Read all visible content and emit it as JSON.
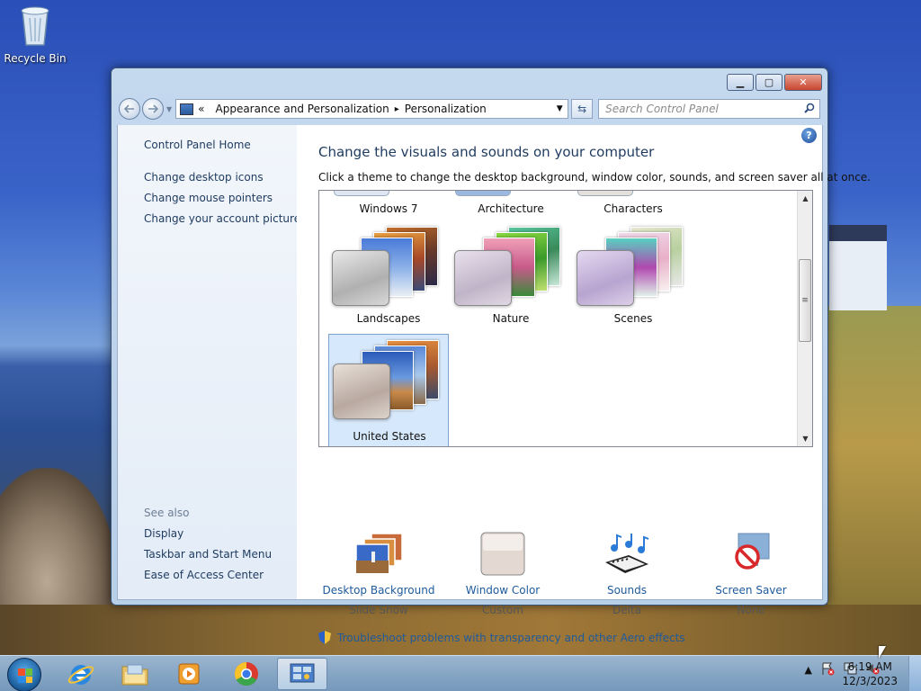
{
  "desktop": {
    "recycle_bin_label": "Recycle Bin"
  },
  "window": {
    "title": "Personalization",
    "controls": {
      "minimize": "▁",
      "maximize": "▢",
      "close": "✕"
    },
    "address": {
      "chevron": "«",
      "crumbs": [
        "Appearance and Personalization",
        "Personalization"
      ],
      "separator": "▸"
    },
    "search": {
      "placeholder": "Search Control Panel"
    }
  },
  "sidebar": {
    "home": "Control Panel Home",
    "tasks": [
      "Change desktop icons",
      "Change mouse pointers",
      "Change your account picture"
    ],
    "see_also_label": "See also",
    "see_also": [
      "Display",
      "Taskbar and Start Menu",
      "Ease of Access Center"
    ]
  },
  "content": {
    "heading": "Change the visuals and sounds on your computer",
    "subheading": "Click a theme to change the desktop background, window color, sounds, and screen saver all at once.",
    "themes_top_row": [
      "Windows 7",
      "Architecture",
      "Characters"
    ],
    "themes": [
      {
        "label": "Landscapes",
        "selected": false
      },
      {
        "label": "Nature",
        "selected": false
      },
      {
        "label": "Scenes",
        "selected": false
      },
      {
        "label": "United States",
        "selected": true
      }
    ],
    "settings": [
      {
        "title": "Desktop Background",
        "value": "Slide Show",
        "icon": "desktop-background-icon"
      },
      {
        "title": "Window Color",
        "value": "Custom",
        "icon": "window-color-icon"
      },
      {
        "title": "Sounds",
        "value": "Delta",
        "icon": "sounds-icon"
      },
      {
        "title": "Screen Saver",
        "value": "None",
        "icon": "screen-saver-icon"
      }
    ],
    "troubleshoot": "Troubleshoot problems with transparency and other Aero effects",
    "help": "?"
  },
  "taskbar": {
    "apps": [
      "internet-explorer",
      "file-explorer",
      "media-player",
      "chrome",
      "control-panel"
    ],
    "active_app": "control-panel",
    "clock_time": "6:19 AM",
    "clock_date": "12/3/2023",
    "tray_expand": "▲"
  },
  "colors": {
    "link": "#1e5a9c",
    "sidebar_link": "#1e3a5f",
    "selection": "#d6e8fb"
  }
}
